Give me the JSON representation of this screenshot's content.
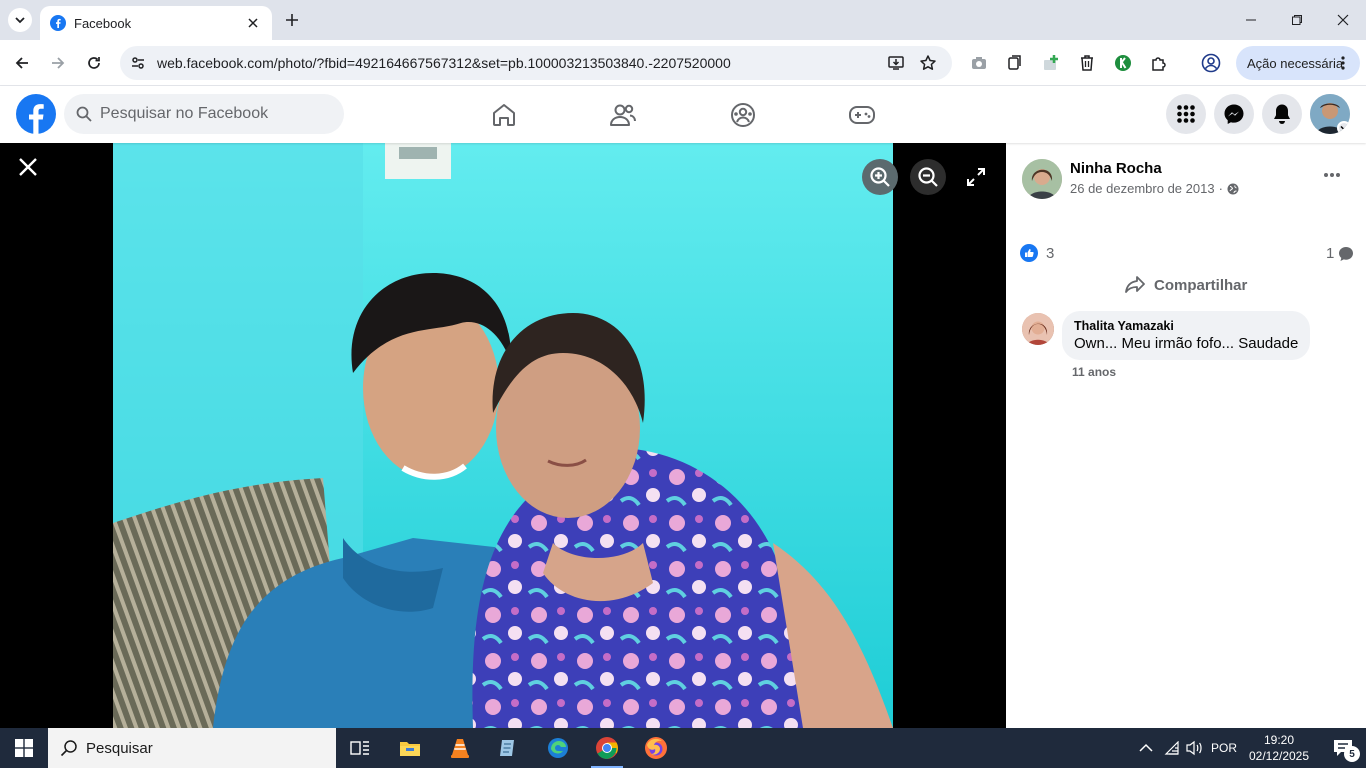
{
  "browser": {
    "tab_title": "Facebook",
    "url": "web.facebook.com/photo/?fbid=492164667567312&set=pb.100003213503840.-2207520000",
    "action_button_label": "Ação necessária"
  },
  "fb": {
    "search_placeholder": "Pesquisar no Facebook",
    "brand_color": "#1877f2"
  },
  "post": {
    "author": "Ninha Rocha",
    "date": "26 de dezembro de 2013",
    "date_separator": "·",
    "reactions_count": "3",
    "comments_count": "1",
    "share_label": "Compartilhar"
  },
  "comments": [
    {
      "name": "Thalita Yamazaki",
      "text": "Own... Meu irmão fofo... Saudade",
      "age": "11 anos"
    }
  ],
  "taskbar": {
    "search_label": "Pesquisar",
    "language": "POR",
    "time": "19:20",
    "date": "02/12/2025",
    "notification_count": "5"
  }
}
